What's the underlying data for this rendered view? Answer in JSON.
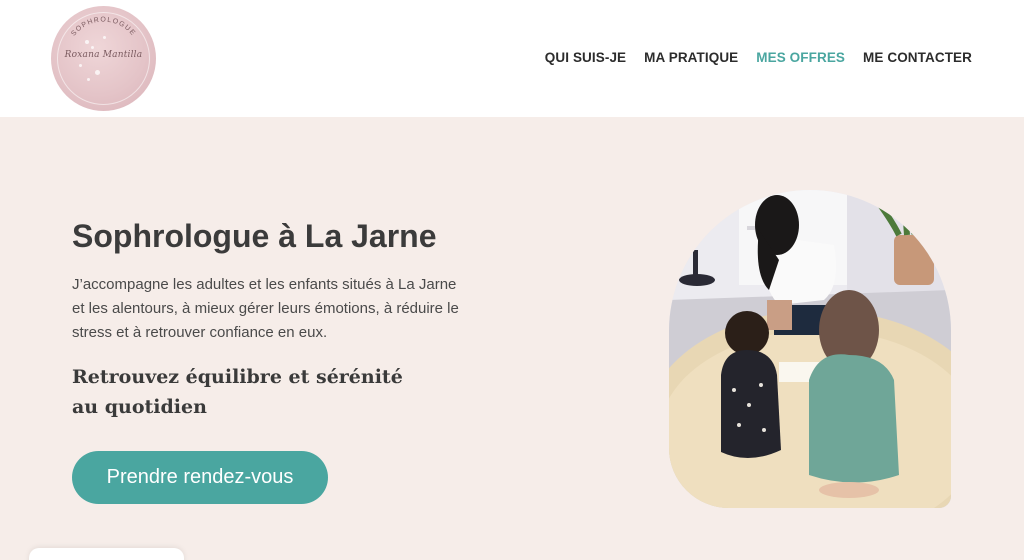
{
  "header": {
    "logo": {
      "arc_text": "SOPHROLOGUE",
      "script_name": "Roxana Mantilla",
      "icon": "logo-emblem"
    },
    "nav": [
      {
        "label": "QUI SUIS-JE"
      },
      {
        "label": "MA PRATIQUE"
      },
      {
        "label": "MES OFFRES",
        "active": true
      },
      {
        "label": "ME CONTACTER"
      }
    ]
  },
  "hero": {
    "title": "Sophrologue à La Jarne",
    "text": "J’accompagne les adultes et les enfants situés à La Jarne et les alentours, à mieux gérer leurs émotions, à réduire le stress et à retrouver confiance en eux.",
    "subtitle": "Retrouvez équilibre et sérénité au quotidien",
    "cta_label": "Prendre rendez-vous"
  },
  "colors": {
    "accent": "#4aa6a0",
    "background": "#f6ede9",
    "header_bg": "#ffffff",
    "logo_pink": "#e4c4c8"
  }
}
